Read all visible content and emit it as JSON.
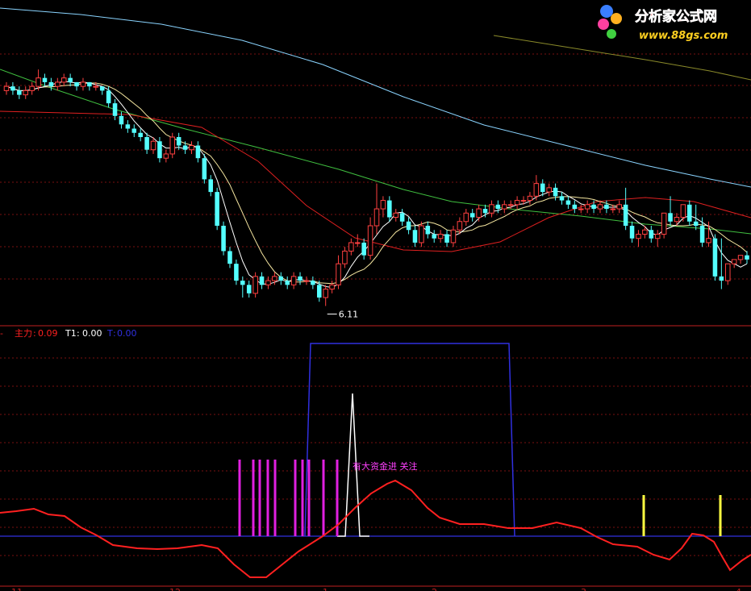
{
  "watermark": {
    "title": "分析家公式网",
    "url": "www.88gs.com"
  },
  "colors": {
    "background": "#000000",
    "grid": "#7a1010",
    "up": "#ff4040",
    "down": "#54ffff",
    "ma_short": "#ffffff",
    "ma_mid": "#f5e6a0",
    "ma_red": "#e02020",
    "ma_green": "#40c040",
    "ma_blue": "#8ad4ff",
    "ma_olive": "#8a8a2a",
    "zhuli": "#ff2020",
    "t_line": "#3030e0",
    "t1_line": "#ffffff",
    "magenta_bar": "#e020e0",
    "yellow_bar": "#ffff40",
    "signal_text": "#ff40ff"
  },
  "chart_data": [
    {
      "type": "candlestick",
      "x": [
        0,
        1,
        2,
        3,
        4,
        5,
        6,
        7,
        8,
        9,
        10,
        11,
        12,
        13,
        14,
        15,
        16,
        17,
        18,
        19,
        20,
        21,
        22,
        23,
        24,
        25,
        26,
        27,
        28,
        29,
        30,
        31,
        32,
        33,
        34,
        35,
        36,
        37,
        38,
        39,
        40,
        41,
        42,
        43,
        44,
        45,
        46,
        47,
        48,
        49,
        50,
        51,
        52,
        53,
        54,
        55,
        56,
        57,
        58,
        59,
        60,
        61,
        62,
        63,
        64,
        65,
        66,
        67,
        68,
        69,
        70,
        71,
        72,
        73,
        74,
        75,
        76,
        77,
        78,
        79,
        80,
        81,
        82,
        83,
        84,
        85,
        86,
        87,
        88,
        89,
        90,
        91,
        92,
        93,
        94,
        95,
        96,
        97,
        98,
        99,
        100,
        101,
        102,
        103,
        104,
        105,
        106,
        107,
        108,
        109,
        110,
        111,
        112,
        113,
        114,
        115,
        116
      ],
      "open": [
        11.0,
        11.1,
        11.0,
        10.9,
        11.0,
        11.1,
        11.3,
        11.2,
        11.1,
        11.2,
        11.3,
        11.2,
        11.1,
        11.2,
        11.1,
        11.1,
        11.0,
        10.7,
        10.4,
        10.2,
        10.1,
        10.0,
        9.9,
        9.6,
        9.8,
        9.4,
        9.5,
        9.9,
        9.7,
        9.6,
        9.7,
        9.4,
        8.9,
        8.6,
        7.8,
        7.2,
        6.9,
        6.5,
        6.4,
        6.2,
        6.6,
        6.4,
        6.5,
        6.6,
        6.5,
        6.4,
        6.6,
        6.5,
        6.5,
        6.4,
        6.1,
        6.3,
        6.4,
        6.9,
        7.2,
        7.4,
        7.4,
        7.1,
        7.8,
        8.2,
        8.4,
        8.0,
        8.1,
        7.9,
        7.7,
        7.4,
        7.8,
        7.6,
        7.5,
        7.6,
        7.4,
        7.7,
        7.9,
        8.1,
        8.0,
        8.2,
        8.1,
        8.3,
        8.2,
        8.3,
        8.3,
        8.4,
        8.4,
        8.5,
        8.8,
        8.6,
        8.7,
        8.5,
        8.4,
        8.3,
        8.2,
        8.2,
        8.3,
        8.2,
        8.3,
        8.2,
        8.2,
        8.3,
        7.8,
        7.5,
        7.6,
        7.7,
        7.5,
        7.6,
        8.1,
        7.9,
        8.0,
        8.3,
        7.9,
        7.8,
        7.4,
        7.5,
        6.6,
        6.5,
        6.9,
        7.0,
        7.1
      ],
      "close": [
        11.1,
        11.0,
        10.9,
        11.0,
        11.1,
        11.3,
        11.2,
        11.1,
        11.2,
        11.3,
        11.2,
        11.1,
        11.2,
        11.1,
        11.1,
        11.0,
        10.7,
        10.4,
        10.2,
        10.1,
        10.0,
        9.9,
        9.6,
        9.8,
        9.4,
        9.5,
        9.9,
        9.7,
        9.6,
        9.7,
        9.4,
        8.9,
        8.6,
        7.8,
        7.2,
        6.9,
        6.5,
        6.4,
        6.2,
        6.6,
        6.4,
        6.5,
        6.6,
        6.5,
        6.4,
        6.6,
        6.5,
        6.5,
        6.4,
        6.1,
        6.3,
        6.4,
        6.9,
        7.2,
        7.4,
        7.4,
        7.1,
        7.8,
        8.2,
        8.4,
        8.0,
        8.1,
        7.9,
        7.7,
        7.4,
        7.8,
        7.6,
        7.5,
        7.6,
        7.4,
        7.7,
        7.9,
        8.1,
        8.0,
        8.2,
        8.1,
        8.3,
        8.2,
        8.3,
        8.3,
        8.4,
        8.4,
        8.5,
        8.8,
        8.6,
        8.7,
        8.5,
        8.4,
        8.3,
        8.2,
        8.2,
        8.3,
        8.2,
        8.3,
        8.2,
        8.2,
        8.3,
        7.8,
        7.5,
        7.6,
        7.7,
        7.5,
        7.6,
        8.1,
        7.9,
        8.0,
        8.3,
        7.9,
        7.8,
        7.4,
        7.5,
        6.6,
        6.5,
        6.9,
        7.0,
        7.1,
        7.0
      ],
      "high": [
        11.2,
        11.2,
        11.1,
        11.1,
        11.2,
        11.5,
        11.4,
        11.3,
        11.3,
        11.4,
        11.4,
        11.2,
        11.3,
        11.2,
        11.2,
        11.1,
        11.1,
        10.8,
        10.5,
        10.3,
        10.2,
        10.1,
        10.0,
        9.9,
        9.9,
        9.6,
        10.0,
        10.0,
        9.8,
        9.8,
        9.8,
        9.5,
        9.0,
        8.7,
        7.9,
        7.3,
        7.0,
        6.6,
        6.5,
        6.7,
        6.7,
        6.6,
        6.7,
        6.7,
        6.6,
        6.7,
        6.7,
        6.6,
        6.6,
        6.5,
        6.4,
        6.5,
        7.1,
        7.3,
        7.5,
        7.6,
        7.5,
        8.0,
        8.8,
        8.5,
        8.5,
        8.2,
        8.2,
        8.0,
        7.8,
        7.9,
        7.9,
        7.7,
        7.7,
        7.7,
        7.8,
        8.0,
        8.2,
        8.2,
        8.3,
        8.3,
        8.4,
        8.4,
        8.4,
        8.4,
        8.5,
        8.5,
        8.6,
        9.0,
        8.9,
        8.8,
        8.8,
        8.6,
        8.5,
        8.4,
        8.3,
        8.4,
        8.4,
        8.4,
        8.4,
        8.3,
        8.4,
        8.7,
        7.9,
        7.7,
        7.8,
        7.8,
        7.7,
        7.7,
        8.5,
        8.1,
        8.1,
        8.4,
        8.3,
        8.0,
        7.9,
        7.6,
        7.5,
        6.7,
        7.0,
        7.1,
        7.2
      ],
      "low": [
        10.9,
        10.9,
        10.8,
        10.8,
        10.9,
        11.0,
        11.1,
        11.0,
        11.0,
        11.1,
        11.1,
        11.0,
        11.0,
        11.0,
        11.0,
        10.9,
        10.6,
        10.3,
        10.1,
        10.0,
        9.9,
        9.8,
        9.5,
        9.5,
        9.3,
        9.3,
        9.4,
        9.6,
        9.5,
        9.5,
        9.3,
        8.8,
        8.5,
        7.7,
        7.1,
        6.8,
        6.4,
        6.1,
        6.1,
        6.1,
        6.3,
        6.3,
        6.4,
        6.4,
        6.3,
        6.3,
        6.4,
        6.4,
        6.3,
        6.0,
        5.9,
        6.2,
        6.3,
        6.8,
        7.1,
        7.3,
        7.0,
        7.0,
        7.6,
        8.0,
        7.9,
        7.9,
        7.8,
        7.6,
        7.3,
        7.3,
        7.5,
        7.4,
        7.4,
        7.3,
        7.3,
        7.6,
        7.8,
        7.9,
        7.9,
        8.0,
        8.0,
        8.1,
        8.1,
        8.2,
        8.2,
        8.3,
        8.3,
        8.4,
        8.5,
        8.5,
        8.4,
        8.3,
        8.2,
        8.1,
        8.1,
        8.1,
        8.1,
        8.1,
        8.1,
        8.1,
        8.1,
        7.7,
        7.4,
        7.3,
        7.5,
        7.4,
        7.3,
        7.5,
        7.8,
        7.8,
        7.9,
        7.8,
        7.7,
        7.3,
        7.3,
        6.5,
        6.3,
        6.4,
        6.8,
        6.9,
        6.9
      ],
      "annotation": {
        "text": "6.11",
        "x": 50
      }
    },
    {
      "type": "line",
      "legend": [
        {
          "label": "主力",
          "value": "0.09"
        },
        {
          "label": "T1",
          "value": "0.00"
        },
        {
          "label": "T",
          "value": "0.00"
        }
      ],
      "annotations": [
        {
          "text": "有大资金进 关注"
        }
      ],
      "x_tick_labels": [
        "11",
        "12",
        "1",
        "2",
        "3",
        "4"
      ]
    }
  ]
}
